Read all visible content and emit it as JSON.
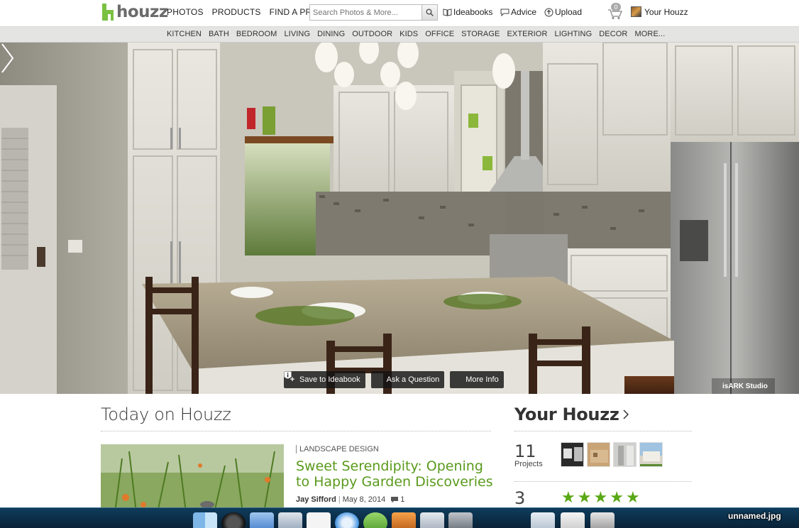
{
  "header": {
    "logo_text": "houzz",
    "nav": [
      "PHOTOS",
      "PRODUCTS",
      "FIND A PRO"
    ],
    "search_placeholder": "Search Photos & More...",
    "ideabooks": "Ideabooks",
    "advice": "Advice",
    "upload": "Upload",
    "cart_count": "0",
    "your_houzz": "Your Houzz"
  },
  "categories": [
    "KITCHEN",
    "BATH",
    "BEDROOM",
    "LIVING",
    "DINING",
    "OUTDOOR",
    "KIDS",
    "OFFICE",
    "STORAGE",
    "EXTERIOR",
    "LIGHTING",
    "DECOR",
    "MORE..."
  ],
  "hero": {
    "save_label": "Save to Ideabook",
    "ask_label": "Ask a Question",
    "info_label": "More Info",
    "credit": "isARK Studio"
  },
  "today": {
    "heading": "Today on Houzz",
    "story": {
      "category": "LANDSCAPE DESIGN",
      "title": "Sweet Serendipity: Opening to Happy Garden Discoveries",
      "author": "Jay Sifford",
      "date": "May 8, 2014",
      "comments": "1"
    }
  },
  "your_houzz": {
    "heading": "Your Houzz",
    "projects_count": "11",
    "projects_label": "Projects",
    "reviews_count": "3",
    "rating_stars": 5
  },
  "dock": {
    "filename": "unnamed.jpg"
  },
  "colors": {
    "brand_green": "#7ac142",
    "link_green": "#5a9a1c",
    "dock_blue": "#0e3c5c"
  }
}
